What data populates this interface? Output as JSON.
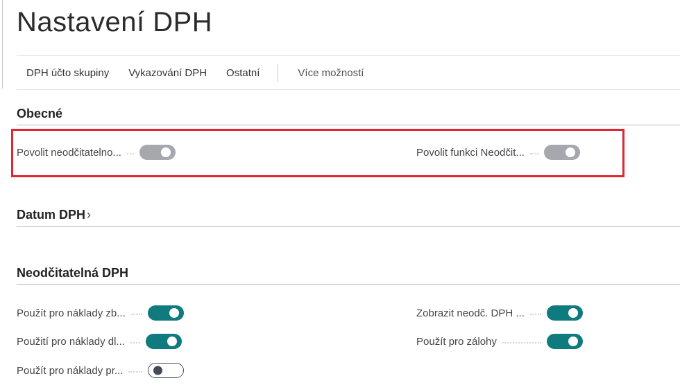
{
  "page": {
    "title": "Nastavení DPH"
  },
  "actions": {
    "items": [
      "DPH účto skupiny",
      "Vykazování DPH",
      "Ostatní"
    ],
    "more": "Více možností"
  },
  "sections": {
    "general": {
      "title": "Obecné",
      "fields": [
        {
          "label": "Povolit neodčitatelno...",
          "state": "on",
          "disabled": true
        },
        {
          "label": "Povolit funkci Neodčit...",
          "state": "on",
          "disabled": true
        }
      ]
    },
    "vat_date": {
      "title": "Datum DPH",
      "chevron": "›"
    },
    "non_deductible": {
      "title": "Neodčitatelná DPH",
      "fields": [
        {
          "label": "Použít pro náklady zb...",
          "state": "on"
        },
        {
          "label": "Zobrazit neodč. DPH ...",
          "state": "on"
        },
        {
          "label": "Použití pro náklady dl...",
          "state": "on"
        },
        {
          "label": "Použít pro zálohy",
          "state": "on"
        },
        {
          "label": "Použít pro náklady pr...",
          "state": "off"
        }
      ]
    }
  },
  "colors": {
    "accent": "#0f7b7f",
    "disabled_toggle": "#a6a8ad",
    "highlight": "#e0262e"
  }
}
